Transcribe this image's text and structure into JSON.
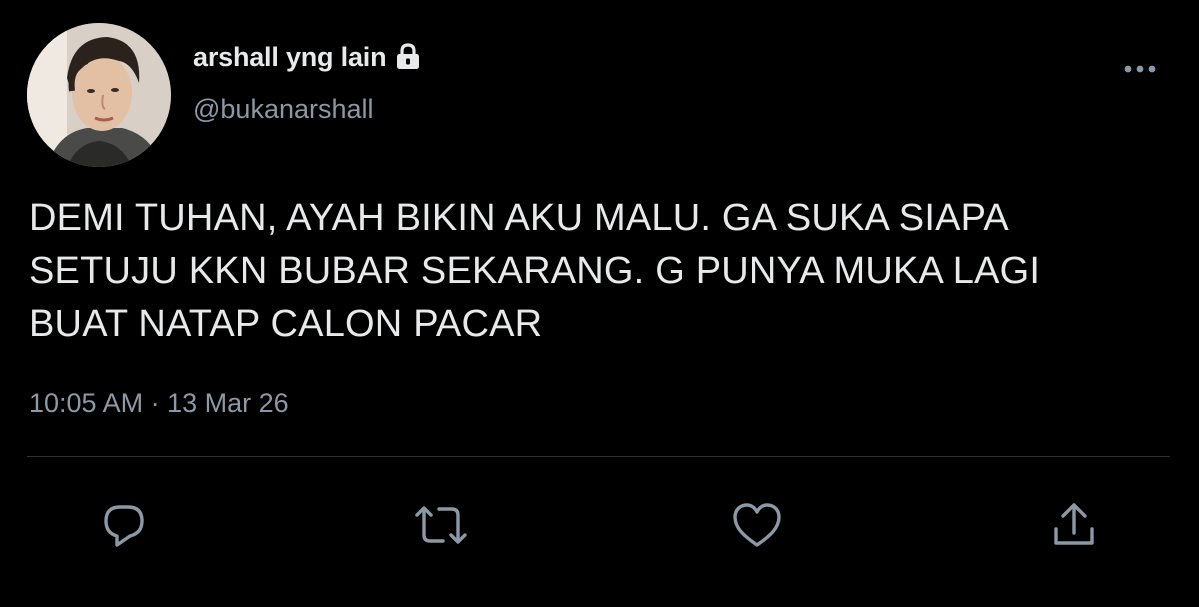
{
  "tweet": {
    "display_name": "arshall yng lain",
    "handle": "@bukanarshall",
    "protected_icon": "lock-icon",
    "text": "DEMI TUHAN, AYAH BIKIN AKU MALU. GA SUKA SIAPA\nSETUJU KKN BUBAR SEKARANG. G PUNYA MUKA LAGI\nBUAT NATAP CALON PACAR",
    "time": "10:05 AM",
    "separator": "·",
    "date": "13 Mar 26"
  },
  "actions": [
    {
      "name": "reply",
      "icon": "reply-icon"
    },
    {
      "name": "retweet",
      "icon": "retweet-icon"
    },
    {
      "name": "like",
      "icon": "heart-icon"
    },
    {
      "name": "share",
      "icon": "share-icon"
    }
  ],
  "colors": {
    "background": "#000000",
    "text_primary": "#e7e9ea",
    "text_secondary": "#8b98a5",
    "icon": "#8b98a5",
    "divider": "#2f3336"
  }
}
